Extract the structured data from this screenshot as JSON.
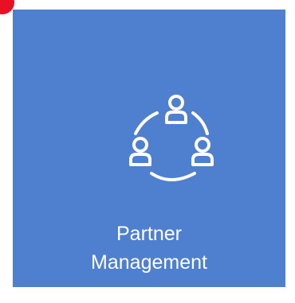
{
  "tile": {
    "label_line1": "Partner",
    "label_line2": "Management",
    "icon": "partner-network-icon",
    "background_color": "#4f7fcf",
    "text_color": "#ffffff"
  },
  "badge": {
    "color": "#e81123"
  }
}
